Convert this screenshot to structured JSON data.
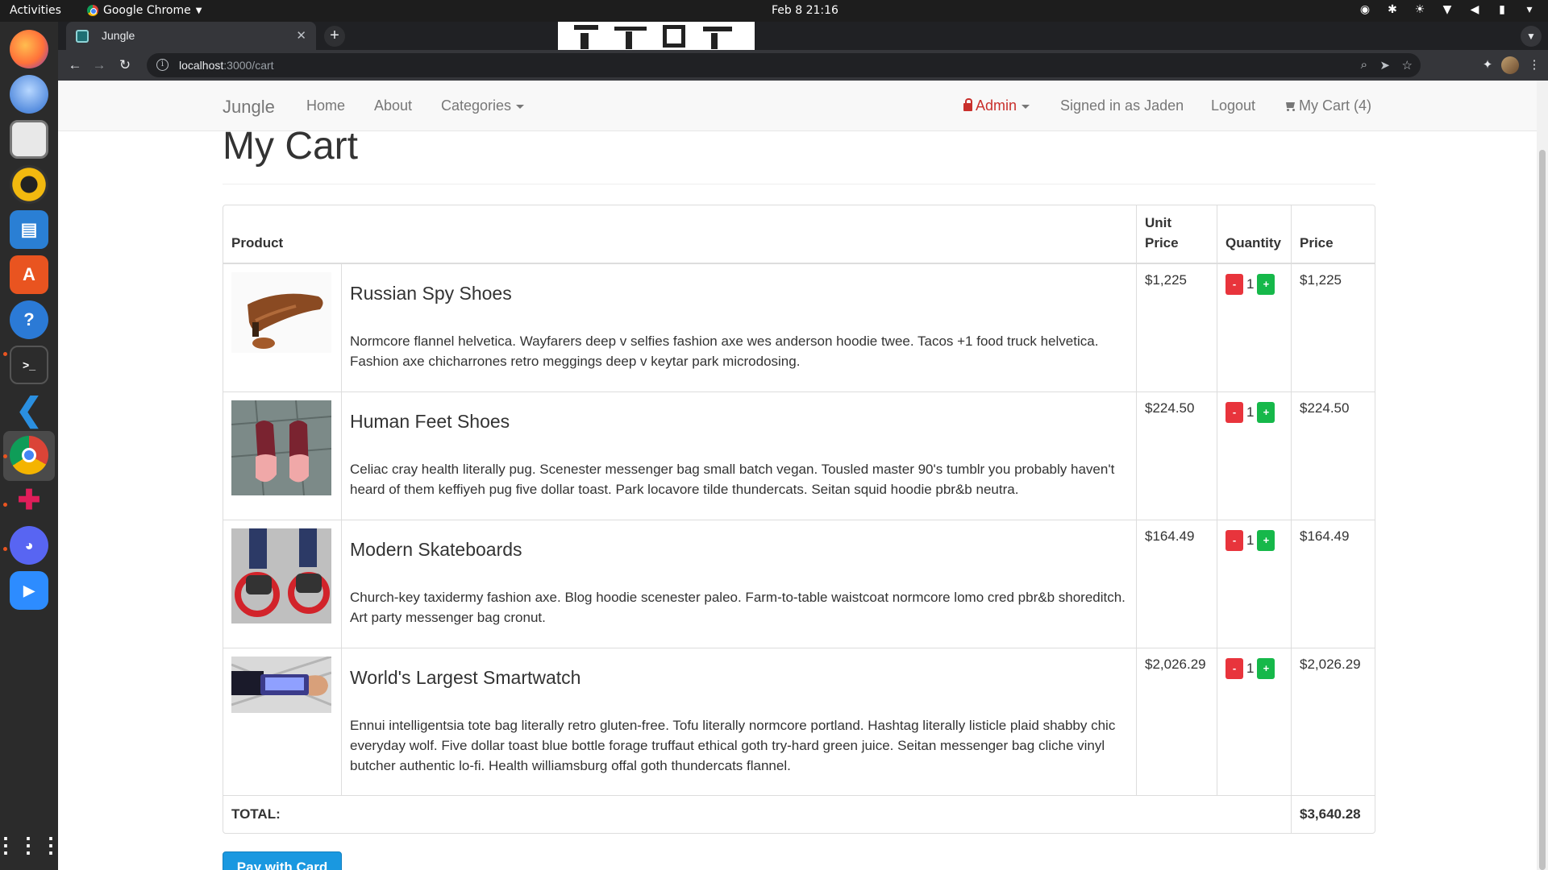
{
  "system": {
    "activities_label": "Activities",
    "app_name": "Google Chrome",
    "clock": "Feb 8  21:16"
  },
  "browser": {
    "tab_title": "Jungle",
    "url_host": "localhost",
    "url_path": ":3000/cart"
  },
  "navbar": {
    "brand": "Jungle",
    "links": [
      "Home",
      "About",
      "Categories"
    ],
    "admin_label": "Admin",
    "signed_in": "Signed in as Jaden",
    "logout": "Logout",
    "cart_label": "My Cart (4)"
  },
  "page": {
    "title": "My Cart"
  },
  "table": {
    "headers": {
      "product": "Product",
      "unit_price_1": "Unit",
      "unit_price_2": "Price",
      "quantity": "Quantity",
      "price": "Price"
    },
    "items": [
      {
        "name": "Russian Spy Shoes",
        "description": "Normcore flannel helvetica. Wayfarers deep v selfies fashion axe wes anderson hoodie twee. Tacos +1 food truck helvetica. Fashion axe chicharrones retro meggings deep v keytar park microdosing.",
        "unit_price": "$1,225",
        "quantity": "1",
        "price": "$1,225",
        "image": "brown-shoe-image"
      },
      {
        "name": "Human Feet Shoes",
        "description": "Celiac cray health literally pug. Scenester messenger bag small batch vegan. Tousled master 90's tumblr you probably haven't heard of them keffiyeh pug five dollar toast. Park locavore tilde thundercats. Seitan squid hoodie pbr&b neutra.",
        "unit_price": "$224.50",
        "quantity": "1",
        "price": "$224.50",
        "image": "feet-shoes-image"
      },
      {
        "name": "Modern Skateboards",
        "description": "Church-key taxidermy fashion axe. Blog hoodie scenester paleo. Farm-to-table waistcoat normcore lomo cred pbr&b shoreditch. Art party messenger bag cronut.",
        "unit_price": "$164.49",
        "quantity": "1",
        "price": "$164.49",
        "image": "skates-image"
      },
      {
        "name": "World's Largest Smartwatch",
        "description": "Ennui intelligentsia tote bag literally retro gluten-free. Tofu literally normcore portland. Hashtag literally listicle plaid shabby chic everyday wolf. Five dollar toast blue bottle forage truffaut ethical goth try-hard green juice. Seitan messenger bag cliche vinyl butcher authentic lo-fi. Health williamsburg offal goth thundercats flannel.",
        "unit_price": "$2,026.29",
        "quantity": "1",
        "price": "$2,026.29",
        "image": "smartwatch-image"
      }
    ],
    "minus_label": "-",
    "plus_label": "+",
    "total_label": "TOTAL:",
    "total_value": "$3,640.28"
  },
  "pay_button": "Pay with Card",
  "colors": {
    "navbar_bg": "#f8f8f8",
    "admin_red": "#c9302c",
    "minus_red": "#e8343c",
    "plus_green": "#16b84a",
    "pay_blue": "#1a98e0"
  }
}
